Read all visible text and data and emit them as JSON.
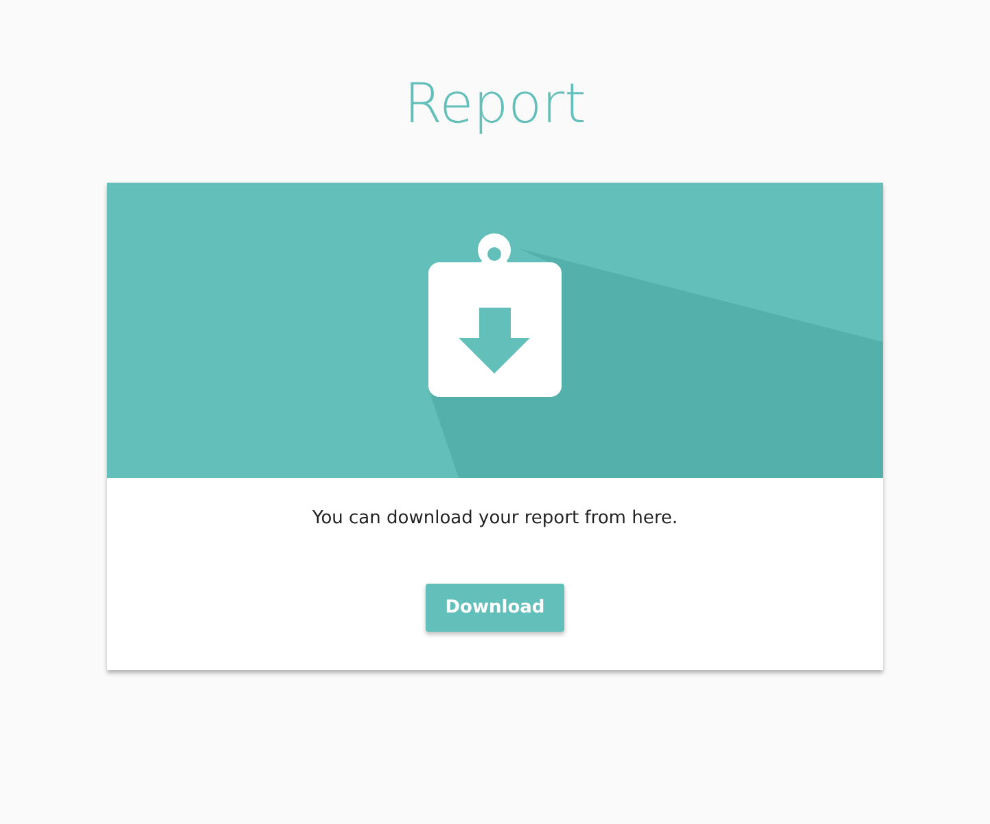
{
  "page_title": "Report",
  "card": {
    "message": "You can download your report from here.",
    "button": {
      "label": "Download"
    }
  }
}
